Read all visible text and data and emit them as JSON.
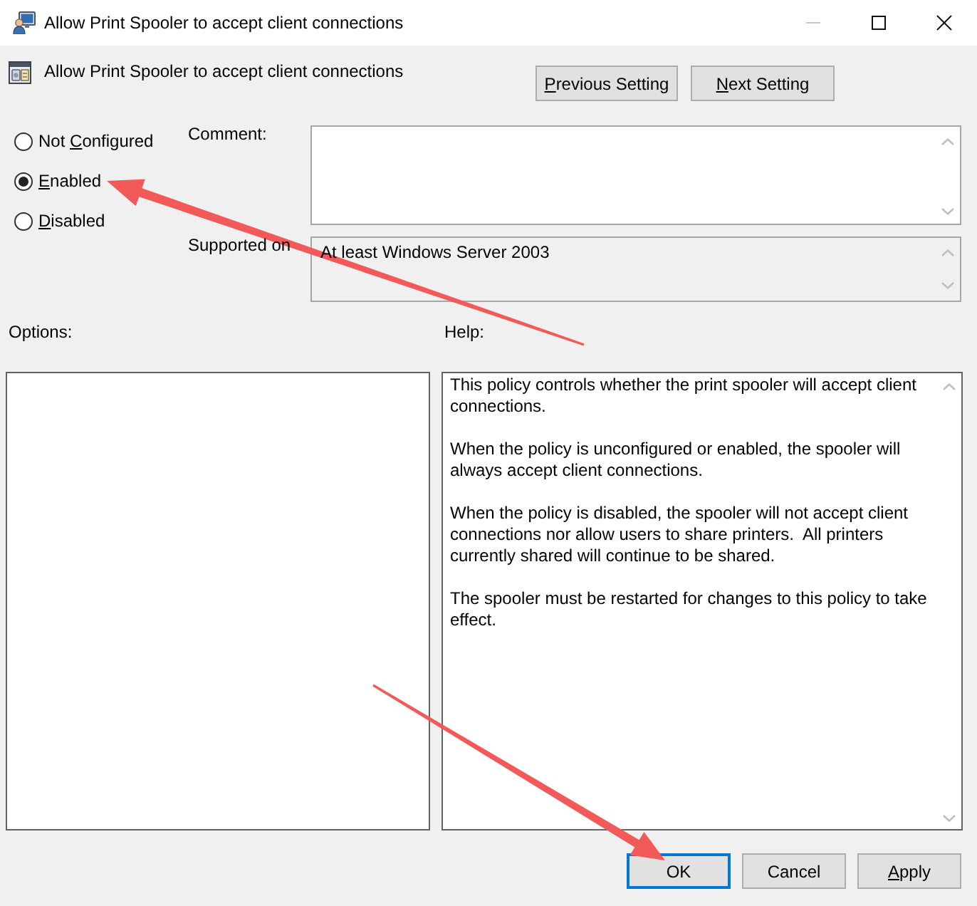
{
  "window": {
    "title": "Allow Print Spooler to accept client connections",
    "controls": [
      {
        "kind": "minimize",
        "disabled": true
      },
      {
        "kind": "maximize",
        "disabled": false
      },
      {
        "kind": "close",
        "disabled": false
      }
    ]
  },
  "header": {
    "title": "Allow Print Spooler to accept client connections",
    "buttons": [
      {
        "parts": [
          {
            "text": "P",
            "underlined": true
          },
          {
            "text": "revious Setting",
            "underlined": false
          }
        ]
      },
      {
        "parts": [
          {
            "text": "N",
            "underlined": true
          },
          {
            "text": "ext Setting",
            "underlined": false
          }
        ]
      }
    ]
  },
  "states": [
    {
      "parts": [
        {
          "text": "Not ",
          "underlined": false
        },
        {
          "text": "C",
          "underlined": true
        },
        {
          "text": "onfigured",
          "underlined": false
        }
      ],
      "selected": false
    },
    {
      "parts": [
        {
          "text": "E",
          "underlined": true
        },
        {
          "text": "nabled",
          "underlined": false
        }
      ],
      "selected": true
    },
    {
      "parts": [
        {
          "text": "D",
          "underlined": true
        },
        {
          "text": "isabled",
          "underlined": false
        }
      ],
      "selected": false
    }
  ],
  "comment": {
    "label": "Comment:"
  },
  "supported_on": {
    "label": "Supported on",
    "value": "At least Windows Server 2003"
  },
  "options": {
    "label": "Options:"
  },
  "help": {
    "label": "Help:",
    "paragraphs": [
      [
        "This policy controls whether the print spooler will accept client",
        "connections."
      ],
      [
        "When the policy is unconfigured or enabled, the spooler will",
        "always accept client connections."
      ],
      [
        "When the policy is disabled, the spooler will not accept client",
        "connections nor allow users to share printers.  All printers",
        "currently shared will continue to be shared."
      ],
      [
        "The spooler must be restarted for changes to this policy to take",
        "effect."
      ]
    ]
  },
  "buttons": [
    {
      "parts": [
        {
          "text": "OK",
          "underlined": false
        }
      ],
      "focused": true
    },
    {
      "parts": [
        {
          "text": "Cancel",
          "underlined": false
        }
      ],
      "focused": false
    },
    {
      "parts": [
        {
          "text": "A",
          "underlined": true
        },
        {
          "text": "pply",
          "underlined": false
        }
      ],
      "focused": false
    }
  ],
  "annotations": [
    {
      "kind": "arrow"
    },
    {
      "kind": "arrow"
    }
  ]
}
